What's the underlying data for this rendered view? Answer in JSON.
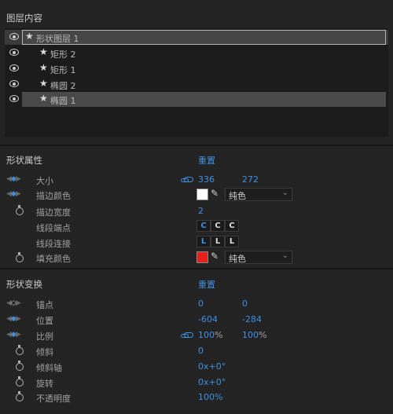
{
  "layers": {
    "title": "图层内容",
    "items": [
      {
        "label": "形状图层 1"
      },
      {
        "label": "矩形 2"
      },
      {
        "label": "矩形 1"
      },
      {
        "label": "椭圆 2"
      },
      {
        "label": "椭圆 1"
      }
    ]
  },
  "shape_props": {
    "title": "形状属性",
    "reset": "重置",
    "size": {
      "label": "大小",
      "w": "336",
      "h": "272"
    },
    "stroke_color": {
      "label": "描边颜色",
      "swatch": "#ffffff",
      "mode": "纯色"
    },
    "stroke_width": {
      "label": "描边宽度",
      "value": "2"
    },
    "line_cap": {
      "label": "线段端点"
    },
    "line_join": {
      "label": "线段连接"
    },
    "fill_color": {
      "label": "填充颜色",
      "swatch": "#e8201c",
      "mode": "纯色"
    }
  },
  "transform": {
    "title": "形状变换",
    "reset": "重置",
    "anchor": {
      "label": "锚点",
      "x": "0",
      "y": "0"
    },
    "position": {
      "label": "位置",
      "x": "-604",
      "y": "-284"
    },
    "scale": {
      "label": "比例",
      "x": "100",
      "y": "100",
      "unit": "%"
    },
    "skew": {
      "label": "倾斜",
      "value": "0"
    },
    "skew_axis": {
      "label": "倾斜轴",
      "value": "0x+0°"
    },
    "rotation": {
      "label": "旋转",
      "value": "0x+0°"
    },
    "opacity": {
      "label": "不透明度",
      "value": "100%"
    }
  },
  "colors": {
    "accent": "#3d8fe0",
    "panel_bg": "#232323",
    "list_bg": "#1b1b1b"
  }
}
